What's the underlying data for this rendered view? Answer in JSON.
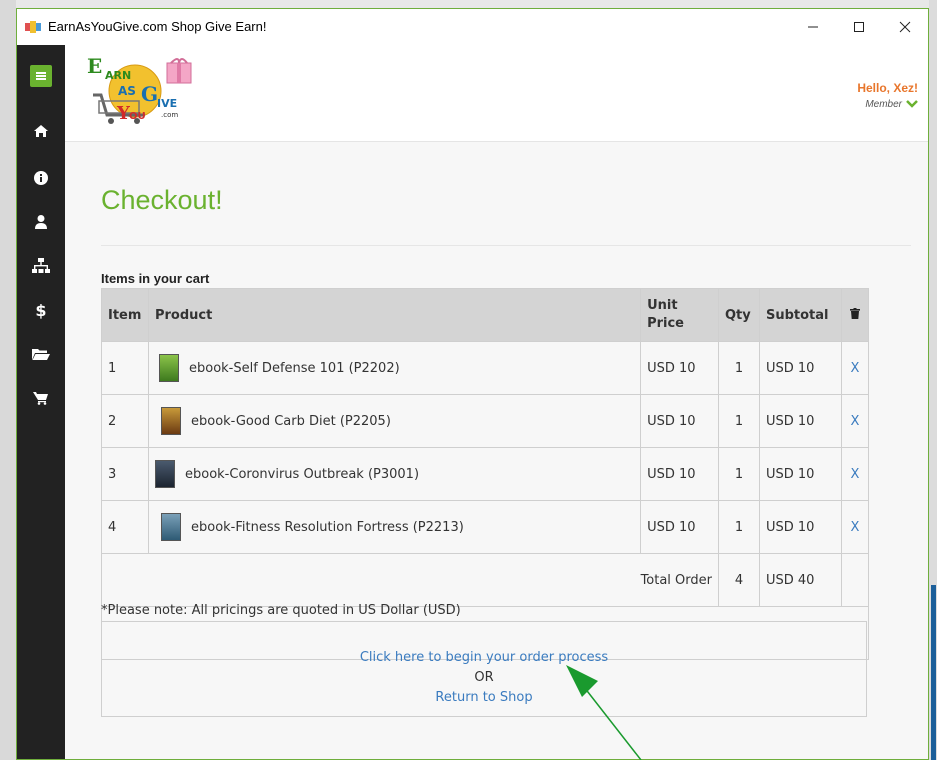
{
  "window": {
    "title": "EarnAsYouGive.com Shop Give Earn!",
    "minimize_icon": "minimize-icon",
    "maximize_icon": "maximize-icon",
    "close_icon": "close-icon"
  },
  "sidebar": {
    "items": [
      {
        "icon": "home-icon"
      },
      {
        "icon": "info-icon"
      },
      {
        "icon": "user-icon"
      },
      {
        "icon": "sitemap-icon"
      },
      {
        "icon": "dollar-icon"
      },
      {
        "icon": "folder-icon"
      },
      {
        "icon": "cart-icon"
      }
    ]
  },
  "header": {
    "logo_text": "EarnAsYouGive.com",
    "greeting": "Hello, Xez!",
    "role": "Member"
  },
  "page": {
    "title": "Checkout!",
    "cart_heading": "Items in your cart",
    "columns": {
      "item": "Item",
      "product": "Product",
      "unit_price_1": "Unit",
      "unit_price_2": "Price",
      "qty": "Qty",
      "subtotal": "Subtotal"
    },
    "rows": [
      {
        "item": "1",
        "product": "ebook-Self Defense 101 (P2202)",
        "unit_price": "USD 10",
        "qty": "1",
        "subtotal": "USD 10",
        "remove": "X"
      },
      {
        "item": "2",
        "product": "ebook-Good Carb Diet (P2205)",
        "unit_price": "USD 10",
        "qty": "1",
        "subtotal": "USD 10",
        "remove": "X"
      },
      {
        "item": "3",
        "product": "ebook-Coronvirus Outbreak (P3001)",
        "unit_price": "USD 10",
        "qty": "1",
        "subtotal": "USD 10",
        "remove": "X"
      },
      {
        "item": "4",
        "product": "ebook-Fitness Resolution Fortress (P2213)",
        "unit_price": "USD 10",
        "qty": "1",
        "subtotal": "USD 10",
        "remove": "X"
      }
    ],
    "total": {
      "label": "Total Order",
      "qty": "4",
      "amount": "USD 40"
    },
    "note": "*Please note: All pricings are quoted in US Dollar (USD)",
    "order_link": "Click here to begin your order process",
    "or_text": "OR",
    "return_link": "Return to Shop"
  },
  "colors": {
    "accent_green": "#6ab22f",
    "sidebar_bg": "#222222",
    "link_blue": "#3a7bbf",
    "greeting_orange": "#e8762c",
    "arrow_green": "#1a9a2e"
  }
}
